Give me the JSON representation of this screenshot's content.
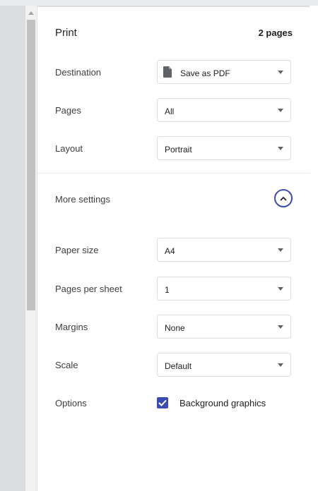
{
  "header": {
    "title": "Print",
    "page_count": "2 pages"
  },
  "settings": {
    "destination": {
      "label": "Destination",
      "value": "Save as PDF"
    },
    "pages": {
      "label": "Pages",
      "value": "All"
    },
    "layout": {
      "label": "Layout",
      "value": "Portrait"
    }
  },
  "more_settings": {
    "label": "More settings",
    "expanded": true
  },
  "advanced": {
    "paper_size": {
      "label": "Paper size",
      "value": "A4"
    },
    "pages_per_sheet": {
      "label": "Pages per sheet",
      "value": "1"
    },
    "margins": {
      "label": "Margins",
      "value": "None"
    },
    "scale": {
      "label": "Scale",
      "value": "Default"
    }
  },
  "options": {
    "label": "Options",
    "background_graphics": {
      "label": "Background graphics",
      "checked": true
    }
  },
  "colors": {
    "accent": "#3c4bb4",
    "border": "#dadce0",
    "text": "#202124"
  }
}
